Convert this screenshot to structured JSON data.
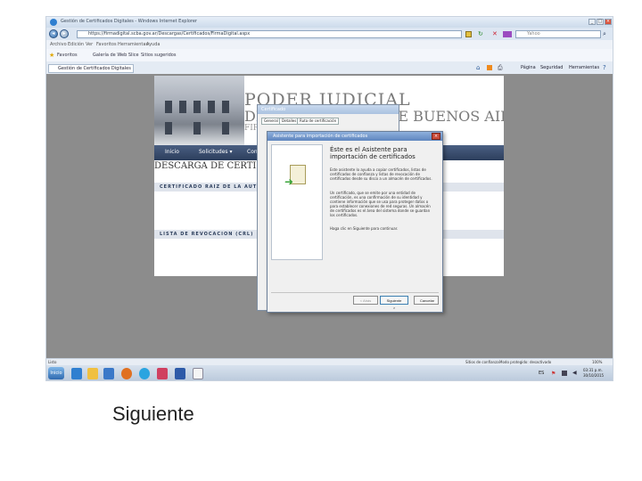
{
  "window": {
    "title": "Gestión de Certificados Digitales - Windows Internet Explorer"
  },
  "address": {
    "url": "https://firmadigital.scba.gov.ar/Descargas/Certificados/FirmaDigital.aspx",
    "search_placeholder": "Yahoo"
  },
  "menu": [
    "Archivo",
    "Edición",
    "Ver",
    "Favoritos",
    "Herramientas",
    "Ayuda"
  ],
  "favorites": {
    "label": "Favoritos",
    "items": [
      "Galería de Web Slice",
      "Sitios sugeridos"
    ]
  },
  "tab": {
    "label": "Gestión de Certificados Digitales"
  },
  "toolbar_right": [
    "Página",
    "Seguridad",
    "Herramientas"
  ],
  "page": {
    "logo_main": "PODER JUDICIAL",
    "logo_sub": "DE LA PROVINCIA DE BUENOS AIRES",
    "logo_sub2": "FIRMA DIGITAL",
    "nav": [
      "Inicio",
      "Solicitudes ▾",
      "Consultas"
    ],
    "heading": "DESCARGA DE CERTIFICADOS",
    "section1": "CERTIFICADO RAIZ DE LA AUTORIDAD CERTIFICANTE",
    "section2": "LISTA DE REVOCACION (CRL)"
  },
  "dialog_back": {
    "title": "Certificado",
    "tabs": [
      "General",
      "Detalles",
      "Ruta de certificación"
    ]
  },
  "wizard": {
    "title": "Asistente para importación de certificados",
    "heading": "Éste es el Asistente para importación de certificados",
    "para1": "Este asistente lo ayuda a copiar certificados, listas de certificados de confianza y listas de revocación de certificados desde su disco a un almacén de certificados.",
    "para2": "Un certificado, que se emite por una entidad de certificación, es una confirmación de su identidad y contiene información que se usa para proteger datos o para establecer conexiones de red seguras. Un almacén de certificados es el área del sistema donde se guardan los certificados.",
    "para3": "Haga clic en Siguiente para continuar.",
    "back_btn": "< Atrás",
    "next_btn": "Siguiente >",
    "cancel_btn": "Cancelar"
  },
  "status": {
    "left": "Listo",
    "mid1": "Sitios de confianza",
    "mid2": "Modo protegido: desactivado",
    "zoom": "100%"
  },
  "taskbar": {
    "start": "Inicio",
    "lang": "ES",
    "time": "03:31 p.m.",
    "date": "30/10/2015"
  },
  "caption": "Siguiente",
  "colors": {
    "nav_blue": "#2c3e5c",
    "wizard_title": "#5f86bf",
    "content_gray": "#8c8c8c"
  }
}
